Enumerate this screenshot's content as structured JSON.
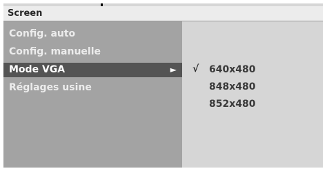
{
  "window": {
    "title": "Screen"
  },
  "menu": {
    "items": [
      {
        "label": "Config. auto",
        "selected": false
      },
      {
        "label": "Config. manuelle",
        "selected": false
      },
      {
        "label": "Mode VGA",
        "selected": true,
        "has_submenu": true
      },
      {
        "label": "Réglages usine",
        "selected": false
      }
    ]
  },
  "submenu": {
    "options": [
      {
        "label": "640x480",
        "checked": true
      },
      {
        "label": "848x480",
        "checked": false
      },
      {
        "label": "852x480",
        "checked": false
      }
    ]
  },
  "icons": {
    "submenu_arrow": "submenu-arrow-icon",
    "check": "check-icon"
  },
  "colors": {
    "panel": "#a3a3a3",
    "selected": "#545454",
    "submenu_bg": "#d6d6d6",
    "title_bar": "#ececec"
  }
}
